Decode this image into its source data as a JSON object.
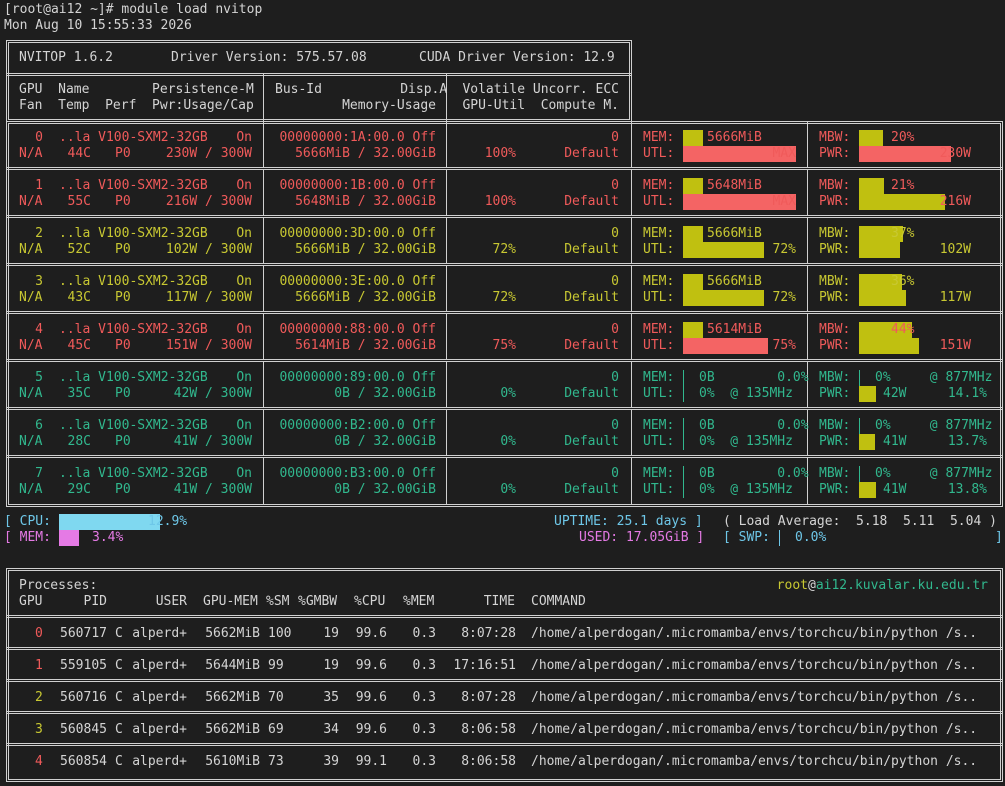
{
  "colors": {
    "red": "#f05a5a",
    "yellow": "#c8c832",
    "green": "#31b88e",
    "cyan": "#6ec7e8",
    "magenta": "#e57ae5",
    "cpu_bar": "#7fd8f0",
    "mem_bar": "#e57ae5",
    "util_red": "#f46464",
    "util_yel": "#c0c010"
  },
  "terminal": {
    "prompt": "[root@ai12 ~]# module load nvitop",
    "date": "Mon Aug 10 15:55:33 2026"
  },
  "header": {
    "nvitop": "NVITOP 1.6.2",
    "driver": "Driver Version: 575.57.08",
    "cuda": "CUDA Driver Version: 12.9"
  },
  "columns": {
    "c1a": "GPU  Name        Persistence-M",
    "c1b": "Fan  Temp  Perf  Pwr:Usage/Cap",
    "c2a": "Bus-Id          Disp.A",
    "c2b": "Memory-Usage",
    "c3a": "Volatile Uncorr. ECC",
    "c3b": "GPU-Util  Compute M."
  },
  "gpus": [
    {
      "color": "red",
      "idx": "0",
      "name": "..la V100-SXM2-32GB",
      "persist": "On",
      "fan": "N/A",
      "temp": "44C",
      "perf": "P0",
      "power": "230W / 300W",
      "bus": "00000000:1A:00.0 Off",
      "mem": "5666MiB / 32.00GiB",
      "ecc": "0",
      "util": "100%",
      "compute": "Default",
      "mem_label": "MEM:",
      "mem_text": "5666MiB",
      "mem_frac": 0.18,
      "utl_label": "UTL:",
      "utl_text": "MAX",
      "utl_frac": 1.0,
      "utl_bar": "red",
      "mbw_label": "MBW:",
      "mbw_text": "20%",
      "mbw_frac": 0.2,
      "pwr_label": "PWR:",
      "pwr_text": "230W",
      "pwr_frac": 0.77,
      "pwr_bar": "red",
      "clk_mem": "",
      "clk_utl": "",
      "pct_pwr": ""
    },
    {
      "color": "red",
      "idx": "1",
      "name": "..la V100-SXM2-32GB",
      "persist": "On",
      "fan": "N/A",
      "temp": "55C",
      "perf": "P0",
      "power": "216W / 300W",
      "bus": "00000000:1B:00.0 Off",
      "mem": "5648MiB / 32.00GiB",
      "ecc": "0",
      "util": "100%",
      "compute": "Default",
      "mem_label": "MEM:",
      "mem_text": "5648MiB",
      "mem_frac": 0.18,
      "utl_label": "UTL:",
      "utl_text": "MAX",
      "utl_frac": 1.0,
      "utl_bar": "red",
      "mbw_label": "MBW:",
      "mbw_text": "21%",
      "mbw_frac": 0.21,
      "pwr_label": "PWR:",
      "pwr_text": "216W",
      "pwr_frac": 0.72,
      "pwr_bar": "yel",
      "clk_mem": "",
      "clk_utl": "",
      "pct_pwr": ""
    },
    {
      "color": "yel",
      "idx": "2",
      "name": "..la V100-SXM2-32GB",
      "persist": "On",
      "fan": "N/A",
      "temp": "52C",
      "perf": "P0",
      "power": "102W / 300W",
      "bus": "00000000:3D:00.0 Off",
      "mem": "5666MiB / 32.00GiB",
      "ecc": "0",
      "util": "72%",
      "compute": "Default",
      "mem_label": "MEM:",
      "mem_text": "5666MiB",
      "mem_frac": 0.18,
      "utl_label": "UTL:",
      "utl_text": "72%",
      "utl_frac": 0.72,
      "utl_bar": "yel",
      "mbw_label": "MBW:",
      "mbw_text": "37%",
      "mbw_frac": 0.37,
      "pwr_label": "PWR:",
      "pwr_text": "102W",
      "pwr_frac": 0.34,
      "pwr_bar": "yel",
      "clk_mem": "",
      "clk_utl": "",
      "pct_pwr": ""
    },
    {
      "color": "yel",
      "idx": "3",
      "name": "..la V100-SXM2-32GB",
      "persist": "On",
      "fan": "N/A",
      "temp": "43C",
      "perf": "P0",
      "power": "117W / 300W",
      "bus": "00000000:3E:00.0 Off",
      "mem": "5666MiB / 32.00GiB",
      "ecc": "0",
      "util": "72%",
      "compute": "Default",
      "mem_label": "MEM:",
      "mem_text": "5666MiB",
      "mem_frac": 0.18,
      "utl_label": "UTL:",
      "utl_text": "72%",
      "utl_frac": 0.72,
      "utl_bar": "yel",
      "mbw_label": "MBW:",
      "mbw_text": "36%",
      "mbw_frac": 0.36,
      "pwr_label": "PWR:",
      "pwr_text": "117W",
      "pwr_frac": 0.39,
      "pwr_bar": "yel",
      "clk_mem": "",
      "clk_utl": "",
      "pct_pwr": ""
    },
    {
      "color": "red",
      "idx": "4",
      "name": "..la V100-SXM2-32GB",
      "persist": "On",
      "fan": "N/A",
      "temp": "45C",
      "perf": "P0",
      "power": "151W / 300W",
      "bus": "00000000:88:00.0 Off",
      "mem": "5614MiB / 32.00GiB",
      "ecc": "0",
      "util": "75%",
      "compute": "Default",
      "mem_label": "MEM:",
      "mem_text": "5614MiB",
      "mem_frac": 0.18,
      "utl_label": "UTL:",
      "utl_text": "75%",
      "utl_frac": 0.75,
      "utl_bar": "red",
      "mbw_label": "MBW:",
      "mbw_text": "44%",
      "mbw_frac": 0.44,
      "pwr_label": "PWR:",
      "pwr_text": "151W",
      "pwr_frac": 0.5,
      "pwr_bar": "yel",
      "clk_mem": "",
      "clk_utl": "",
      "pct_pwr": ""
    },
    {
      "color": "grn",
      "idx": "5",
      "name": "..la V100-SXM2-32GB",
      "persist": "On",
      "fan": "N/A",
      "temp": "35C",
      "perf": "P0",
      "power": "42W / 300W",
      "bus": "00000000:89:00.0 Off",
      "mem": "0B / 32.00GiB",
      "ecc": "0",
      "util": "0%",
      "compute": "Default",
      "mem_label": "MEM:",
      "mem_text": "0B        0.0%",
      "mem_frac": 0,
      "utl_label": "UTL:",
      "utl_text": "0%  @ 135MHz",
      "utl_frac": 0,
      "utl_bar": "yel",
      "mbw_label": "MBW:",
      "mbw_text": "0%     @ 877MHz",
      "mbw_frac": 0,
      "pwr_label": "PWR:",
      "pwr_text": "42W",
      "pwr_frac": 0.14,
      "pwr_bar": "yel",
      "clk_mem": "",
      "clk_utl": "",
      "pct_pwr": "14.1%"
    },
    {
      "color": "grn",
      "idx": "6",
      "name": "..la V100-SXM2-32GB",
      "persist": "On",
      "fan": "N/A",
      "temp": "28C",
      "perf": "P0",
      "power": "41W / 300W",
      "bus": "00000000:B2:00.0 Off",
      "mem": "0B / 32.00GiB",
      "ecc": "0",
      "util": "0%",
      "compute": "Default",
      "mem_label": "MEM:",
      "mem_text": "0B        0.0%",
      "mem_frac": 0,
      "utl_label": "UTL:",
      "utl_text": "0%  @ 135MHz",
      "utl_frac": 0,
      "utl_bar": "yel",
      "mbw_label": "MBW:",
      "mbw_text": "0%     @ 877MHz",
      "mbw_frac": 0,
      "pwr_label": "PWR:",
      "pwr_text": "41W",
      "pwr_frac": 0.137,
      "pwr_bar": "yel",
      "clk_mem": "",
      "clk_utl": "",
      "pct_pwr": "13.7%"
    },
    {
      "color": "grn",
      "idx": "7",
      "name": "..la V100-SXM2-32GB",
      "persist": "On",
      "fan": "N/A",
      "temp": "29C",
      "perf": "P0",
      "power": "41W / 300W",
      "bus": "00000000:B3:00.0 Off",
      "mem": "0B / 32.00GiB",
      "ecc": "0",
      "util": "0%",
      "compute": "Default",
      "mem_label": "MEM:",
      "mem_text": "0B        0.0%",
      "mem_frac": 0,
      "utl_label": "UTL:",
      "utl_text": "0%  @ 135MHz",
      "utl_frac": 0,
      "utl_bar": "yel",
      "mbw_label": "MBW:",
      "mbw_text": "0%     @ 877MHz",
      "mbw_frac": 0,
      "pwr_label": "PWR:",
      "pwr_text": "41W",
      "pwr_frac": 0.138,
      "pwr_bar": "yel",
      "clk_mem": "",
      "clk_utl": "",
      "pct_pwr": "13.8%"
    }
  ],
  "system": {
    "cpu_label": "[ CPU:",
    "cpu_pct": "12.9%",
    "cpu_frac": 0.129,
    "mem_label": "[ MEM:",
    "mem_pct": "3.4%",
    "mem_frac": 0.034,
    "uptime": "UPTIME: 25.1 days ]",
    "load": "( Load Average:  5.18  5.11  5.04 )",
    "used": "USED: 17.05GiB ]",
    "swp_label": "[ SWP:",
    "swp_pct": "0.0%",
    "swp_end": "]"
  },
  "processes": {
    "title": "Processes:",
    "host_user": "root",
    "host_at": "@",
    "host_name": "ai12.kuvalar.ku.edu.tr",
    "headers": {
      "gpu": "GPU",
      "pid": "PID",
      "user": "USER",
      "gpumem": "GPU-MEM",
      "sm": "%SM",
      "gmbw": "%GMBW",
      "cpu": "%CPU",
      "mem": "%MEM",
      "time": "TIME",
      "command": "COMMAND"
    },
    "rows": [
      {
        "color": "red",
        "gpu": "0",
        "pid": "560717",
        "type": "C",
        "user": "alperd+",
        "gpumem": "5662MiB",
        "sm": "100",
        "gmbw": "19",
        "cpu": "99.6",
        "mem": "0.3",
        "time": "8:07:28",
        "command": "/home/alperdogan/.micromamba/envs/torchcu/bin/python /s.."
      },
      {
        "color": "red",
        "gpu": "1",
        "pid": "559105",
        "type": "C",
        "user": "alperd+",
        "gpumem": "5644MiB",
        "sm": "99",
        "gmbw": "19",
        "cpu": "99.6",
        "mem": "0.3",
        "time": "17:16:51",
        "command": "/home/alperdogan/.micromamba/envs/torchcu/bin/python /s.."
      },
      {
        "color": "yel",
        "gpu": "2",
        "pid": "560716",
        "type": "C",
        "user": "alperd+",
        "gpumem": "5662MiB",
        "sm": "70",
        "gmbw": "35",
        "cpu": "99.6",
        "mem": "0.3",
        "time": "8:07:28",
        "command": "/home/alperdogan/.micromamba/envs/torchcu/bin/python /s.."
      },
      {
        "color": "yel",
        "gpu": "3",
        "pid": "560845",
        "type": "C",
        "user": "alperd+",
        "gpumem": "5662MiB",
        "sm": "69",
        "gmbw": "34",
        "cpu": "99.6",
        "mem": "0.3",
        "time": "8:06:58",
        "command": "/home/alperdogan/.micromamba/envs/torchcu/bin/python /s.."
      },
      {
        "color": "red",
        "gpu": "4",
        "pid": "560854",
        "type": "C",
        "user": "alperd+",
        "gpumem": "5610MiB",
        "sm": "73",
        "gmbw": "39",
        "cpu": "99.1",
        "mem": "0.3",
        "time": "8:06:58",
        "command": "/home/alperdogan/.micromamba/envs/torchcu/bin/python /s.."
      }
    ]
  }
}
